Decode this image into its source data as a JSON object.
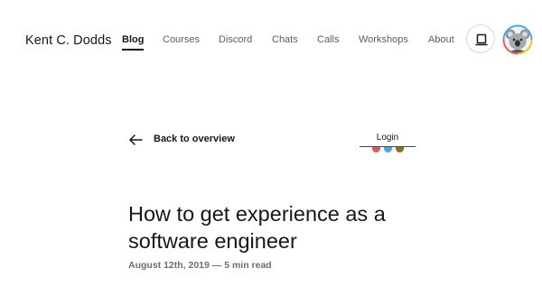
{
  "header": {
    "site_title": "Kent C. Dodds",
    "nav": [
      {
        "label": "Blog",
        "active": true
      },
      {
        "label": "Courses",
        "active": false
      },
      {
        "label": "Discord",
        "active": false
      },
      {
        "label": "Chats",
        "active": false
      },
      {
        "label": "Calls",
        "active": false
      },
      {
        "label": "Workshops",
        "active": false
      },
      {
        "label": "About",
        "active": false
      }
    ],
    "theme_toggle_icon": "laptop-icon",
    "avatar_icon": "koala-avatar-icon"
  },
  "back_link": {
    "label": "Back to overview",
    "icon": "arrow-left-icon"
  },
  "login": {
    "label": "Login",
    "team_colors": [
      "#ea5353",
      "#4aa3eb",
      "#8a7412"
    ]
  },
  "post": {
    "title": "How to get experience as a software engineer",
    "meta": "August 12th, 2019 — 5 min read"
  }
}
